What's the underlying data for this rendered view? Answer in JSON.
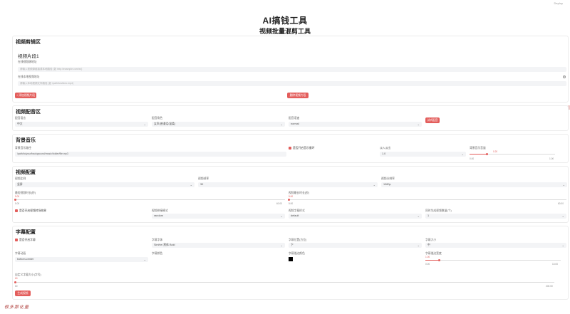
{
  "app": {
    "title": "AI搞钱工具",
    "subtitle": "视频批量混剪工具",
    "corner": "Deploy",
    "footer": "很多那化量"
  },
  "clip_panel": {
    "title": "视频剪辑区",
    "card_title": "视频片段1",
    "url_label": "在线视频源地址",
    "url_placeholder": "请输入视频源链接或本地路径 (如 http://example.com/xx)",
    "local_label": "在线本地视频地址",
    "local_placeholder": "请输入本地视频文件路径 (如 /path/to/video.mp4)",
    "add_button": "+ 添加视频片段",
    "delete_button": "删除视频片段"
  },
  "dub_panel": {
    "title": "视频配音区",
    "lang_label": "配音语言",
    "lang_value": "中文",
    "voice_label": "配音角色",
    "voice_value": "女声(普通话/温柔)",
    "speed_label": "配音语速",
    "speed_value": "normal",
    "test_button": "试听配音"
  },
  "music_panel": {
    "title": "背景音乐",
    "path_label": "背景音乐路径",
    "path_value": "/path/to/your/background/music/folder/file.mp3",
    "loop_label": "是否开启音乐循环",
    "fade_label": "淡入淡出",
    "fade_value": "1.0",
    "volume_label": "背景音乐音量",
    "volume_value": "0.20",
    "volume_fraction": 0.2,
    "volume_min": "0.00",
    "volume_max": "1.00"
  },
  "video_panel": {
    "title": "视频配置",
    "ratio_label": "视频比例",
    "ratio_value": "竖屏",
    "fps_label": "视频帧率",
    "fps_value": "30",
    "res_label": "视频分辨率",
    "res_value": "1080p",
    "min_label": "最短视频时长(秒)",
    "min_value": "5.00",
    "min_fraction": 0.0,
    "min_min": "5.00",
    "min_max": "60.00",
    "max_label": "视频最长时长(秒)",
    "max_value": "5.00",
    "max_fraction": 0.0,
    "max_min": "5.00",
    "max_max": "60.00",
    "transition_label": "是否开启视频转场效果",
    "concat_label": "视频拼接模式",
    "concat_value": "random",
    "sub_label": "视频字幕样式",
    "sub_value": "default",
    "count_label": "同时生成视频数量(个)",
    "count_value": "1"
  },
  "subtitle_panel": {
    "title": "字幕配置",
    "enable_label": "是否开启字幕",
    "font_label": "字幕字体",
    "font_value": "SimHei 黑体 Bold",
    "pos_label": "字幕位置(方位)",
    "pos_value": "下",
    "size_label": "字幕大小",
    "size_value": "中",
    "anim_label": "字幕动画",
    "anim_value": "bottom-center",
    "color_label": "字幕颜色",
    "stroke_color_label": "字幕描边颜色",
    "stroke_color": "#000000",
    "stroke_width_label": "字幕描边宽度",
    "stroke_width_value": "1.00",
    "stroke_width_fraction": 0.1,
    "stroke_min": "0.00",
    "stroke_max": "10.00",
    "font_size_label": "自定义字幕大小(字号)",
    "font_size_value": "60",
    "font_size_fraction": 0.0,
    "font_size_min": "60",
    "font_size_max": "200.00",
    "generate_button": "生成视频"
  },
  "colors": {
    "accent": "#e35d5b",
    "input_bg": "#f3f4f6"
  }
}
